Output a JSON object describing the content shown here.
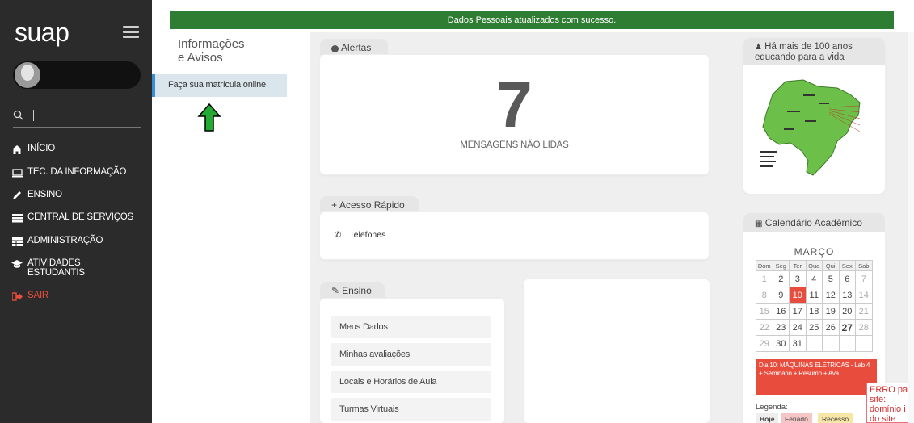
{
  "sidebar": {
    "logo": "suap",
    "search_placeholder": "",
    "nav": [
      {
        "label": "INÍCIO",
        "icon": "home-icon"
      },
      {
        "label": "TEC. DA INFORMAÇÃO",
        "icon": "monitor-icon"
      },
      {
        "label": "ENSINO",
        "icon": "pencil-icon"
      },
      {
        "label": "CENTRAL DE SERVIÇOS",
        "icon": "list-icon"
      },
      {
        "label": "ADMINISTRAÇÃO",
        "icon": "table-icon"
      },
      {
        "label": "ATIVIDADES",
        "label2": "ESTUDANTIS",
        "icon": "graduation-cap-icon"
      },
      {
        "label": "SAIR",
        "icon": "sign-out-icon"
      }
    ]
  },
  "banner": {
    "message": "Dados Pessoais atualizados com sucesso."
  },
  "info": {
    "title_line1": "Informações",
    "title_line2": "e Avisos",
    "item": "Faça sua matrícula online."
  },
  "alerts": {
    "tab": "Alertas",
    "count": "7",
    "label": "MENSAGENS NÃO LIDAS"
  },
  "quick_access": {
    "tab": "Acesso Rápido",
    "phone": "Telefones"
  },
  "ensino": {
    "tab": "Ensino",
    "items": [
      "Meus Dados",
      "Minhas avaliações",
      "Locais e Horários de Aula",
      "Turmas Virtuais"
    ]
  },
  "history": {
    "line1": "Há mais de 100 anos",
    "line2": "educando para a vida"
  },
  "calendar": {
    "title": "Calendário Acadêmico",
    "month": "MARÇO",
    "weekdays": [
      "Dom",
      "Seg",
      "Ter",
      "Qua",
      "Qui",
      "Sex",
      "Sab"
    ],
    "rows": [
      [
        "1",
        "2",
        "3",
        "4",
        "5",
        "6",
        "7"
      ],
      [
        "8",
        "9",
        "10",
        "11",
        "12",
        "13",
        "14"
      ],
      [
        "15",
        "16",
        "17",
        "18",
        "19",
        "20",
        "21"
      ],
      [
        "22",
        "23",
        "24",
        "25",
        "26",
        "27",
        "28"
      ],
      [
        "29",
        "30",
        "31",
        "",
        "",
        "",
        ""
      ]
    ],
    "event": "Dia 10: MÁQUINAS ELÉTRICAS - Lab 4 + Seminário + Resumo + Ava",
    "legend_label": "Legenda:",
    "legend": [
      "Hoje",
      "Feriado",
      "Recesso"
    ],
    "highlight_color": "#e74c3c"
  },
  "error": {
    "text": "ERRO par site: domínio i do site"
  },
  "colors": {
    "sidebar": "#2b2b2b",
    "banner": "#2e7d32",
    "info_accent": "#3a8fd1",
    "arrow": "#22aa33"
  }
}
